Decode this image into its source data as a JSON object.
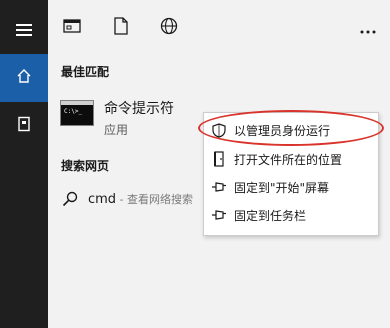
{
  "rail": {
    "items": [
      {
        "icon": "hamburger-menu-icon"
      },
      {
        "icon": "home-icon",
        "active": true
      },
      {
        "icon": "documents-icon"
      }
    ]
  },
  "topbar": {
    "icons": [
      "apps-filter-icon",
      "documents-filter-icon",
      "web-filter-icon",
      "more-icon"
    ]
  },
  "best_match": {
    "heading": "最佳匹配",
    "title": "命令提示符",
    "subtitle": "应用",
    "thumb_text": "C:\\>_"
  },
  "web": {
    "heading": "搜索网页",
    "query": "cmd",
    "hint": " - 查看网络搜索"
  },
  "context_menu": {
    "items": [
      {
        "label": "以管理员身份运行",
        "icon": "shield-icon"
      },
      {
        "label": "打开文件所在的位置",
        "icon": "folder-open-icon"
      },
      {
        "label": "固定到\"开始\"屏幕",
        "icon": "pin-icon"
      },
      {
        "label": "固定到任务栏",
        "icon": "pin-icon"
      }
    ]
  },
  "colors": {
    "rail_bg": "#1f1f1f",
    "active_blue": "#1b5fa8",
    "panel_bg": "#f2f2f2",
    "highlight_red": "#d9342b"
  }
}
